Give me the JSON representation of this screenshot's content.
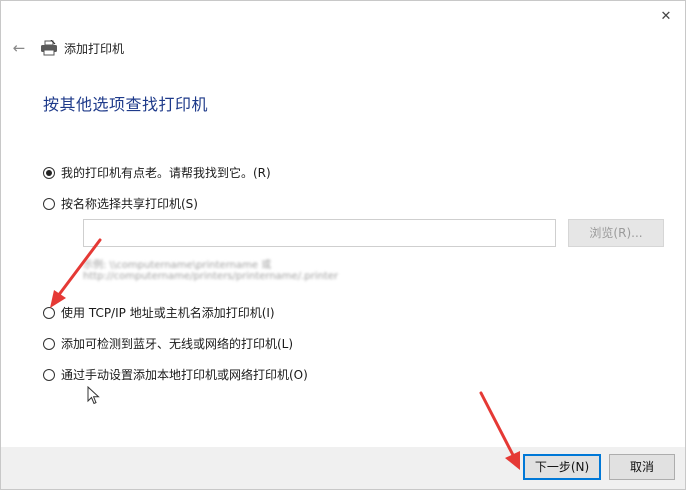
{
  "window": {
    "title": "添加打印机",
    "close_glyph": "✕",
    "back_glyph": "←"
  },
  "heading": "按其他选项查找打印机",
  "options": [
    {
      "label": "我的打印机有点老。请帮我找到它。(R)",
      "checked": true
    },
    {
      "label": "按名称选择共享打印机(S)",
      "checked": false
    },
    {
      "label": "使用 TCP/IP 地址或主机名添加打印机(I)",
      "checked": false
    },
    {
      "label": "添加可检测到蓝牙、无线或网络的打印机(L)",
      "checked": false
    },
    {
      "label": "通过手动设置添加本地打印机或网络打印机(O)",
      "checked": false
    }
  ],
  "shared_printer": {
    "input_value": "",
    "browse_label": "浏览(R)...",
    "example_line1": "示例: \\\\computername\\printername 或",
    "example_line2": "http://computername/printers/printername/.printer"
  },
  "footer": {
    "next_label": "下一步(N)",
    "cancel_label": "取消"
  },
  "colors": {
    "accent": "#0078d7",
    "heading": "#1e3a8a",
    "annotation_arrow": "#e53935"
  }
}
